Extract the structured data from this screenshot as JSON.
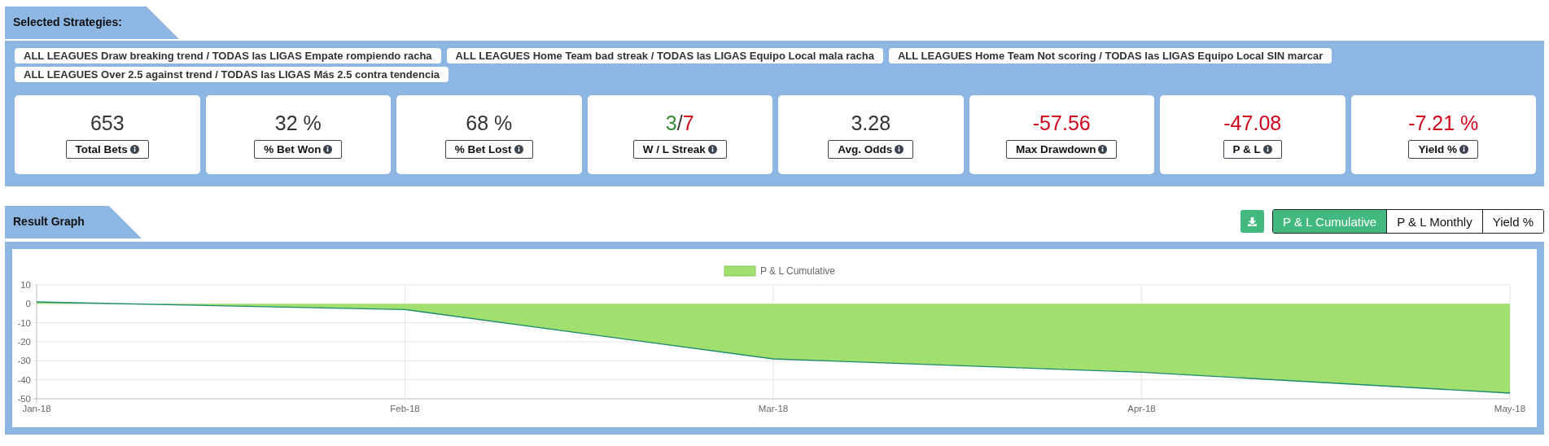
{
  "strategies_section": {
    "title": "Selected Strategies:",
    "strategies": [
      {
        "label": "ALL LEAGUES Draw breaking trend / TODAS las LIGAS Empate rompiendo racha"
      },
      {
        "label": "ALL LEAGUES Home Team bad streak / TODAS las LIGAS Equipo Local mala racha"
      },
      {
        "label": "ALL LEAGUES Home Team Not scoring / TODAS las LIGAS Equipo Local SIN marcar"
      },
      {
        "label": "ALL LEAGUES Over 2.5 against trend / TODAS las LIGAS Más 2.5 contra tendencia"
      }
    ],
    "stats": [
      {
        "value_parts": [
          {
            "text": "653",
            "color": "#333333"
          }
        ],
        "label": "Total Bets"
      },
      {
        "value_parts": [
          {
            "text": "32 %",
            "color": "#333333"
          }
        ],
        "label": "% Bet Won"
      },
      {
        "value_parts": [
          {
            "text": "68 %",
            "color": "#333333"
          }
        ],
        "label": "% Bet Lost"
      },
      {
        "value_parts": [
          {
            "text": "3",
            "color": "#3c8a3c"
          },
          {
            "text": "/",
            "color": "#333333"
          },
          {
            "text": "7",
            "color": "#d0021b"
          }
        ],
        "label": "W / L Streak"
      },
      {
        "value_parts": [
          {
            "text": "3.28",
            "color": "#333333"
          }
        ],
        "label": "Avg. Odds"
      },
      {
        "value_parts": [
          {
            "text": "-57.56",
            "color": "#d0021b"
          }
        ],
        "label": "Max Drawdown"
      },
      {
        "value_parts": [
          {
            "text": "-47.08",
            "color": "#d0021b"
          }
        ],
        "label": "P & L"
      },
      {
        "value_parts": [
          {
            "text": "-7.21 %",
            "color": "#d0021b"
          }
        ],
        "label": "Yield %"
      }
    ]
  },
  "result_section": {
    "title": "Result Graph",
    "view_tabs": [
      {
        "label": "P & L Cumulative",
        "selected": true
      },
      {
        "label": "P & L Monthly",
        "selected": false
      },
      {
        "label": "Yield %",
        "selected": false
      }
    ],
    "chart_data": {
      "type": "area",
      "categories": [
        "Jan-18",
        "Feb-18",
        "Mar-18",
        "Apr-18",
        "May-18"
      ],
      "series": [
        {
          "name": "P & L Cumulative",
          "color": "#a1e06f",
          "values": [
            1,
            -3,
            -29,
            -36,
            -47
          ]
        }
      ],
      "grid": true,
      "ylim": [
        -50,
        10
      ],
      "yticks": [
        10,
        0,
        -10,
        -20,
        -30,
        -40,
        -50
      ]
    }
  }
}
